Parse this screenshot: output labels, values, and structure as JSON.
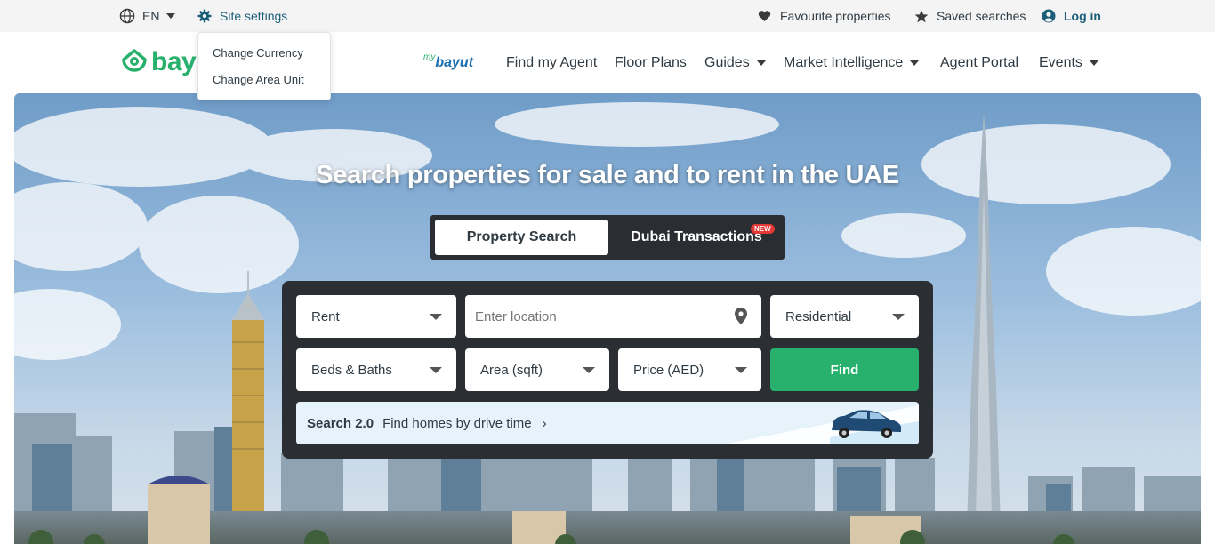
{
  "topbar": {
    "language": "EN",
    "site_settings": "Site settings",
    "favourites": "Favourite properties",
    "saved_searches": "Saved searches",
    "login": "Log in"
  },
  "settings_menu": {
    "items": [
      "Change Currency",
      "Change Area Unit"
    ]
  },
  "header": {
    "logo_text": "bay",
    "mybayut": {
      "prefix": "my",
      "name": "bayut"
    },
    "nav": [
      {
        "label": "Find my Agent",
        "has_dropdown": false
      },
      {
        "label": "Floor Plans",
        "has_dropdown": false
      },
      {
        "label": "Guides",
        "has_dropdown": true
      },
      {
        "label": "Market Intelligence",
        "has_dropdown": true
      },
      {
        "label": "Agent Portal",
        "has_dropdown": false
      },
      {
        "label": "Events",
        "has_dropdown": true
      }
    ]
  },
  "hero": {
    "title": "Search properties for sale and to rent in the UAE",
    "tabs": [
      {
        "label": "Property Search",
        "active": true
      },
      {
        "label": "Dubai Transactions",
        "active": false,
        "badge": "NEW"
      }
    ]
  },
  "search": {
    "purpose": "Rent",
    "location_placeholder": "Enter location",
    "category": "Residential",
    "beds_baths": "Beds & Baths",
    "area": "Area (sqft)",
    "price": "Price (AED)",
    "find_label": "Find",
    "search20_bold": "Search 2.0",
    "search20_text": "Find homes by drive time",
    "search20_chevron": "›"
  },
  "colors": {
    "brand_green": "#28b16d",
    "link_blue": "#1b5e7a",
    "panel_dark": "#2b2e33"
  },
  "icons": [
    "globe-icon",
    "gear-icon",
    "heart-icon",
    "star-icon",
    "user-circle-icon",
    "location-pin-icon",
    "car-icon"
  ]
}
